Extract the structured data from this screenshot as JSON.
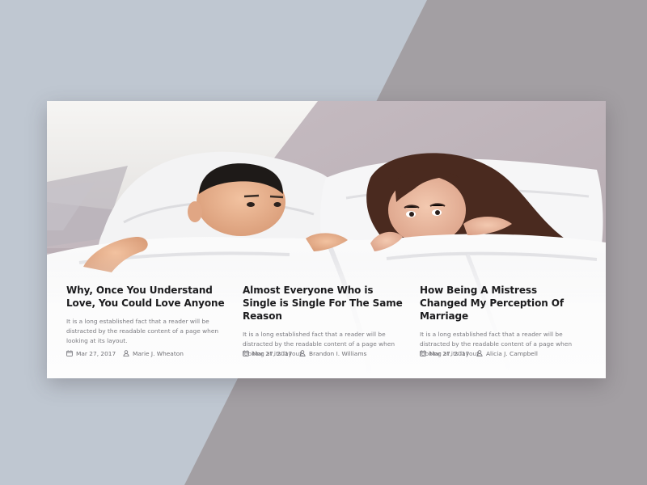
{
  "colors": {
    "backdrop_left": "#bfc7d1",
    "backdrop_right": "#a39fa3",
    "title": "#1c1c1e",
    "excerpt": "#7b7b80",
    "meta": "#6f6f74"
  },
  "posts": [
    {
      "title": "Why, Once You Understand Love, You Could Love Anyone",
      "excerpt": "It is a long established fact that a reader will be distracted by the readable content of a page when looking at its layout.",
      "date": "Mar 27, 2017",
      "author": "Marie J. Wheaton",
      "date_icon": "calendar-icon",
      "author_icon": "user-icon"
    },
    {
      "title": "Almost Everyone Who is Single is Single For The Same Reason",
      "excerpt": "It is a long established fact that a reader will be distracted by the readable content of a page when looking at its layout.",
      "date": "Mar 27, 2017",
      "author": "Brandon I. Williams",
      "date_icon": "calendar-icon",
      "author_icon": "user-icon"
    },
    {
      "title": "How Being A Mistress Changed My Perception Of Marriage",
      "excerpt": "It is a long established fact that a reader will be distracted by the readable content of a page when looking at its layout.",
      "date": "Mar 27, 2017",
      "author": "Alicia J. Campbell",
      "date_icon": "calendar-icon",
      "author_icon": "user-icon"
    }
  ]
}
